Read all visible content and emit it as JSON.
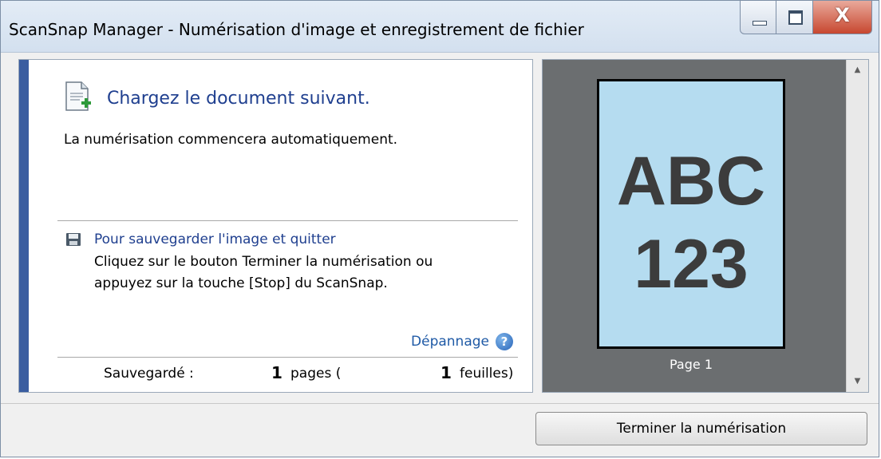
{
  "window": {
    "title": "ScanSnap Manager - Numérisation d'image et enregistrement de fichier",
    "close_glyph": "X"
  },
  "main": {
    "heading": "Chargez le document suivant.",
    "subtext": "La numérisation commencera automatiquement.",
    "save_link": "Pour sauvegarder l'image et quitter",
    "instruction_line1": "Cliquez sur le bouton Terminer la numérisation ou",
    "instruction_line2": "appuyez sur la touche [Stop] du ScanSnap.",
    "troubleshoot": "Dépannage",
    "help_glyph": "?"
  },
  "status": {
    "saved_label": "Sauvegardé :",
    "pages_count": "1",
    "pages_label": "pages (",
    "sheets_count": "1",
    "sheets_label": "feuilles)"
  },
  "preview": {
    "thumb_line1": "ABC",
    "thumb_line2": "123",
    "page_label": "Page 1"
  },
  "footer": {
    "finish_button": "Terminer la numérisation"
  },
  "colors": {
    "accent_bar": "#3a5da0",
    "link": "#1f3f8f",
    "preview_bg": "#6b6e70",
    "thumbnail_bg": "#b5dcf0",
    "close_button": "#c7472f"
  },
  "icons": [
    "document-add-icon",
    "floppy-disk-icon",
    "help-icon",
    "minimize-icon",
    "maximize-icon",
    "close-icon",
    "scroll-up-icon",
    "scroll-down-icon"
  ]
}
